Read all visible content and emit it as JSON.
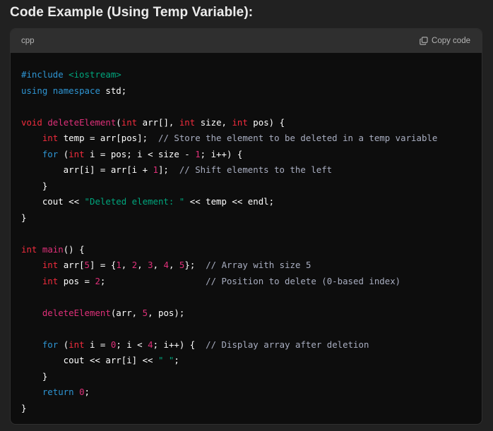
{
  "heading": "Code Example (Using Temp Variable):",
  "code_block": {
    "language": "cpp",
    "copy_label": "Copy code",
    "copy_icon": "copy-icon",
    "colors": {
      "keyword": "#2e95d3",
      "type": "#f22c3d",
      "function": "#df3079",
      "number": "#df3079",
      "string": "#00a67d",
      "comment": "#a9aec1",
      "plain": "#ffffff"
    },
    "lines": [
      [
        [
          "kw",
          "#include "
        ],
        [
          "str",
          "<iostream>"
        ]
      ],
      [
        [
          "kw",
          "using"
        ],
        [
          "plain",
          " "
        ],
        [
          "kw",
          "namespace"
        ],
        [
          "plain",
          " std;"
        ]
      ],
      [],
      [
        [
          "type",
          "void"
        ],
        [
          "plain",
          " "
        ],
        [
          "fn",
          "deleteElement"
        ],
        [
          "plain",
          "("
        ],
        [
          "type",
          "int"
        ],
        [
          "plain",
          " arr[], "
        ],
        [
          "type",
          "int"
        ],
        [
          "plain",
          " size, "
        ],
        [
          "type",
          "int"
        ],
        [
          "plain",
          " pos) {"
        ]
      ],
      [
        [
          "plain",
          "    "
        ],
        [
          "type",
          "int"
        ],
        [
          "plain",
          " temp = arr[pos];  "
        ],
        [
          "cmt",
          "// Store the element to be deleted in a temp variable"
        ]
      ],
      [
        [
          "plain",
          "    "
        ],
        [
          "kw",
          "for"
        ],
        [
          "plain",
          " ("
        ],
        [
          "type",
          "int"
        ],
        [
          "plain",
          " i = pos; i < size - "
        ],
        [
          "num",
          "1"
        ],
        [
          "plain",
          "; i++) {"
        ]
      ],
      [
        [
          "plain",
          "        arr[i] = arr[i + "
        ],
        [
          "num",
          "1"
        ],
        [
          "plain",
          "];  "
        ],
        [
          "cmt",
          "// Shift elements to the left"
        ]
      ],
      [
        [
          "plain",
          "    }"
        ]
      ],
      [
        [
          "plain",
          "    cout << "
        ],
        [
          "str",
          "\"Deleted element: \""
        ],
        [
          "plain",
          " << temp << endl;"
        ]
      ],
      [
        [
          "plain",
          "}"
        ]
      ],
      [],
      [
        [
          "type",
          "int"
        ],
        [
          "plain",
          " "
        ],
        [
          "fn",
          "main"
        ],
        [
          "plain",
          "() {"
        ]
      ],
      [
        [
          "plain",
          "    "
        ],
        [
          "type",
          "int"
        ],
        [
          "plain",
          " arr["
        ],
        [
          "num",
          "5"
        ],
        [
          "plain",
          "] = {"
        ],
        [
          "num",
          "1"
        ],
        [
          "plain",
          ", "
        ],
        [
          "num",
          "2"
        ],
        [
          "plain",
          ", "
        ],
        [
          "num",
          "3"
        ],
        [
          "plain",
          ", "
        ],
        [
          "num",
          "4"
        ],
        [
          "plain",
          ", "
        ],
        [
          "num",
          "5"
        ],
        [
          "plain",
          "};  "
        ],
        [
          "cmt",
          "// Array with size 5"
        ]
      ],
      [
        [
          "plain",
          "    "
        ],
        [
          "type",
          "int"
        ],
        [
          "plain",
          " pos = "
        ],
        [
          "num",
          "2"
        ],
        [
          "plain",
          ";                   "
        ],
        [
          "cmt",
          "// Position to delete (0-based index)"
        ]
      ],
      [],
      [
        [
          "plain",
          "    "
        ],
        [
          "fn",
          "deleteElement"
        ],
        [
          "plain",
          "(arr, "
        ],
        [
          "num",
          "5"
        ],
        [
          "plain",
          ", pos);"
        ]
      ],
      [],
      [
        [
          "plain",
          "    "
        ],
        [
          "kw",
          "for"
        ],
        [
          "plain",
          " ("
        ],
        [
          "type",
          "int"
        ],
        [
          "plain",
          " i = "
        ],
        [
          "num",
          "0"
        ],
        [
          "plain",
          "; i < "
        ],
        [
          "num",
          "4"
        ],
        [
          "plain",
          "; i++) {  "
        ],
        [
          "cmt",
          "// Display array after deletion"
        ]
      ],
      [
        [
          "plain",
          "        cout << arr[i] << "
        ],
        [
          "str",
          "\" \""
        ],
        [
          "plain",
          ";"
        ]
      ],
      [
        [
          "plain",
          "    }"
        ]
      ],
      [
        [
          "plain",
          "    "
        ],
        [
          "kw",
          "return"
        ],
        [
          "plain",
          " "
        ],
        [
          "num",
          "0"
        ],
        [
          "plain",
          ";"
        ]
      ],
      [
        [
          "plain",
          "}"
        ]
      ]
    ]
  }
}
